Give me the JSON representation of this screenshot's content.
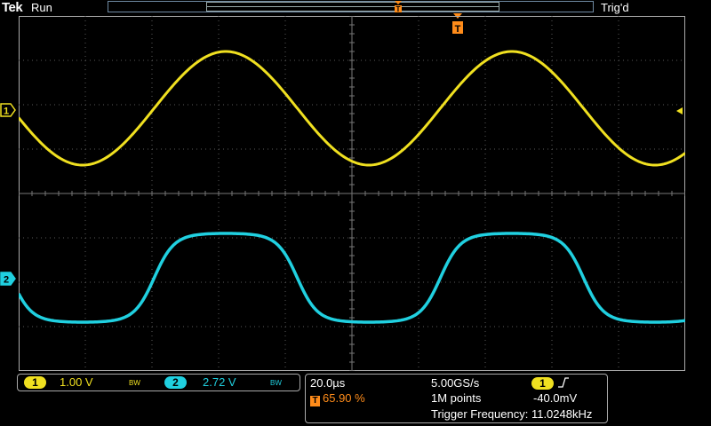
{
  "header": {
    "brand": "Tek",
    "acquisition_state": "Run",
    "trigger_status": "Trig'd"
  },
  "channels": [
    {
      "id": "1",
      "label": "1",
      "color": "#f0e020",
      "scale": "1.00 V",
      "bandwidth_flag": "BW"
    },
    {
      "id": "2",
      "label": "2",
      "color": "#20d0e0",
      "scale": "2.72 V",
      "bandwidth_flag": "BW"
    }
  ],
  "horizontal": {
    "time_per_div": "20.0µs",
    "sample_rate": "5.00GS/s",
    "record_length": "1M points",
    "trigger_position": "65.90 %"
  },
  "trigger": {
    "source": "1",
    "slope": "rising",
    "level": "-40.0mV",
    "frequency_readout": "Trigger Frequency: 11.0248kHz",
    "marker_letter": "T",
    "marker_color": "#ff8c1a"
  },
  "colors": {
    "grid": "#5a5a5a",
    "background": "#000000",
    "frame": "#aaaaaa"
  }
}
